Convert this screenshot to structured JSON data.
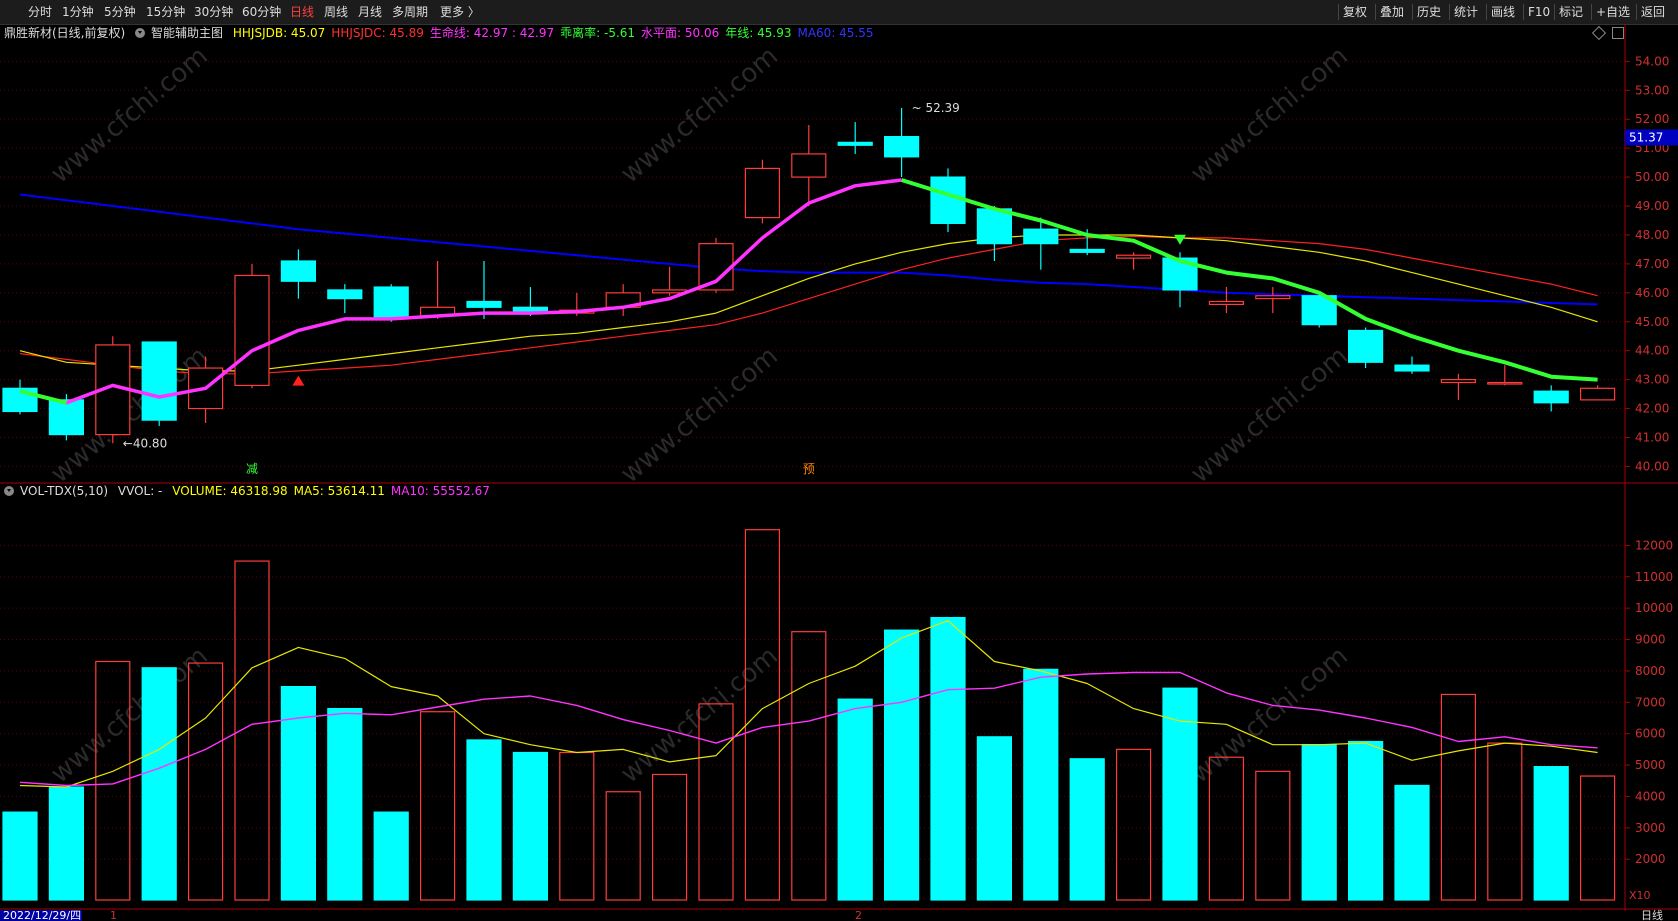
{
  "toolbar": {
    "periods": [
      "分时",
      "1分钟",
      "5分钟",
      "15分钟",
      "30分钟",
      "60分钟",
      "日线",
      "周线",
      "月线",
      "多周期",
      "更多 〉"
    ],
    "active_period": "日线",
    "right_buttons": [
      "复权",
      "叠加",
      "历史",
      "统计",
      "画线",
      "F10",
      "标记",
      "+自选",
      "返回"
    ]
  },
  "main_legend": {
    "stock": "鼎胜新材(日线,前复权)",
    "indicator": "智能辅助主图",
    "items": [
      {
        "text": "HHJSJDB: 45.07",
        "color": "#ffff00"
      },
      {
        "text": "HHJSJDC: 45.89",
        "color": "#ff3030"
      },
      {
        "text": "生命线: 42.97 : 42.97",
        "color": "#ff33ff"
      },
      {
        "text": "乖离率: -5.61",
        "color": "#33ff33"
      },
      {
        "text": "水平面: 50.06",
        "color": "#ff33ff"
      },
      {
        "text": "年线: 45.93",
        "color": "#33ff33"
      },
      {
        "text": "MA60: 45.55",
        "color": "#3333ff"
      }
    ]
  },
  "vol_legend": {
    "name": "VOL-TDX(5,10)",
    "vvol": "VVOL: -",
    "items": [
      {
        "text": "VOLUME: 46318.98",
        "color": "#ffff00"
      },
      {
        "text": "MA5: 53614.11",
        "color": "#ffff00"
      },
      {
        "text": "MA10: 55552.67",
        "color": "#ff33ff"
      }
    ]
  },
  "annotations": {
    "high_label": "52.39",
    "low_label": "40.80",
    "price_tag": "51.37",
    "signal_jian": "减",
    "signal_yu": "预",
    "vol_unit": "X10",
    "date_label": "2022/12/29/四",
    "month_1": "1",
    "month_2": "2",
    "period_label": "日线",
    "watermark": "www.cfchi.com"
  },
  "colors": {
    "up": "#ff3b3b",
    "down": "#00ffff",
    "grid": "#5a0000",
    "lifeline": "#ff33ff",
    "green_line": "#33ff33",
    "ma60": "#0000ff",
    "yellow": "#e6e600",
    "red_line": "#ff2020"
  },
  "chart_data": [
    {
      "type": "candlestick",
      "title": "鼎胜新材(日线,前复权)",
      "ylim": [
        39.6,
        54.6
      ],
      "y_ticks": [
        "54.00",
        "53.00",
        "52.00",
        "51.00",
        "50.00",
        "49.00",
        "48.00",
        "47.00",
        "46.00",
        "45.00",
        "44.00",
        "43.00",
        "42.00",
        "41.00",
        "40.00"
      ],
      "candles": [
        {
          "o": 42.7,
          "h": 43.0,
          "l": 41.8,
          "c": 41.9
        },
        {
          "o": 42.3,
          "h": 42.5,
          "l": 40.9,
          "c": 41.1
        },
        {
          "o": 41.1,
          "h": 44.5,
          "l": 40.8,
          "c": 44.2
        },
        {
          "o": 44.3,
          "h": 44.3,
          "l": 41.4,
          "c": 41.6
        },
        {
          "o": 42.0,
          "h": 43.8,
          "l": 41.5,
          "c": 43.4
        },
        {
          "o": 42.8,
          "h": 47.0,
          "l": 42.7,
          "c": 46.6
        },
        {
          "o": 47.1,
          "h": 47.5,
          "l": 45.8,
          "c": 46.4
        },
        {
          "o": 46.1,
          "h": 46.3,
          "l": 45.3,
          "c": 45.8
        },
        {
          "o": 46.2,
          "h": 46.3,
          "l": 45.0,
          "c": 45.1
        },
        {
          "o": 45.2,
          "h": 47.1,
          "l": 45.1,
          "c": 45.5
        },
        {
          "o": 45.7,
          "h": 47.1,
          "l": 45.1,
          "c": 45.5
        },
        {
          "o": 45.5,
          "h": 46.2,
          "l": 45.2,
          "c": 45.3
        },
        {
          "o": 45.3,
          "h": 46.0,
          "l": 45.2,
          "c": 45.4
        },
        {
          "o": 45.5,
          "h": 46.3,
          "l": 45.2,
          "c": 46.0
        },
        {
          "o": 46.0,
          "h": 46.9,
          "l": 45.9,
          "c": 46.1
        },
        {
          "o": 46.1,
          "h": 47.9,
          "l": 46.0,
          "c": 47.7
        },
        {
          "o": 48.6,
          "h": 50.6,
          "l": 48.4,
          "c": 50.3
        },
        {
          "o": 50.0,
          "h": 51.8,
          "l": 49.0,
          "c": 50.8
        },
        {
          "o": 51.2,
          "h": 51.9,
          "l": 50.8,
          "c": 51.1
        },
        {
          "o": 51.4,
          "h": 52.39,
          "l": 50.0,
          "c": 50.7
        },
        {
          "o": 50.0,
          "h": 50.3,
          "l": 48.1,
          "c": 48.4
        },
        {
          "o": 48.9,
          "h": 49.0,
          "l": 47.1,
          "c": 47.7
        },
        {
          "o": 48.2,
          "h": 48.6,
          "l": 46.8,
          "c": 47.7
        },
        {
          "o": 47.5,
          "h": 48.2,
          "l": 47.3,
          "c": 47.4
        },
        {
          "o": 47.2,
          "h": 47.4,
          "l": 46.8,
          "c": 47.3
        },
        {
          "o": 47.2,
          "h": 47.4,
          "l": 45.5,
          "c": 46.1
        },
        {
          "o": 45.6,
          "h": 46.2,
          "l": 45.3,
          "c": 45.7
        },
        {
          "o": 45.8,
          "h": 46.2,
          "l": 45.3,
          "c": 45.9
        },
        {
          "o": 45.9,
          "h": 46.0,
          "l": 44.8,
          "c": 44.9
        },
        {
          "o": 44.7,
          "h": 44.8,
          "l": 43.4,
          "c": 43.6
        },
        {
          "o": 43.5,
          "h": 43.8,
          "l": 43.2,
          "c": 43.3
        },
        {
          "o": 42.9,
          "h": 43.2,
          "l": 42.3,
          "c": 43.0
        },
        {
          "o": 42.9,
          "h": 43.5,
          "l": 42.8,
          "c": 42.9
        },
        {
          "o": 42.6,
          "h": 42.8,
          "l": 41.9,
          "c": 42.2
        },
        {
          "o": 42.3,
          "h": 42.8,
          "l": 42.3,
          "c": 42.7
        }
      ],
      "lines": [
        {
          "name": "生命线",
          "color": "#ff33ff",
          "values": [
            42.6,
            42.2,
            42.8,
            42.4,
            42.7,
            44.0,
            44.7,
            45.1,
            45.1,
            45.2,
            45.3,
            45.3,
            45.35,
            45.5,
            45.8,
            46.4,
            47.9,
            49.1,
            49.7,
            49.9,
            null,
            null,
            null,
            null,
            null,
            null,
            null,
            null,
            null,
            null,
            null,
            null,
            null,
            null,
            null
          ]
        },
        {
          "name": "乖离率",
          "color": "#33ff33",
          "values": [
            42.6,
            42.2,
            null,
            null,
            null,
            null,
            null,
            null,
            null,
            null,
            null,
            null,
            null,
            null,
            null,
            null,
            null,
            null,
            null,
            49.9,
            49.4,
            48.9,
            48.5,
            48.0,
            47.8,
            47.1,
            46.7,
            46.5,
            46.0,
            45.1,
            44.5,
            44.0,
            43.6,
            43.1,
            43.0
          ]
        },
        {
          "name": "MA60",
          "color": "#0000ff",
          "values": [
            49.4,
            49.2,
            49.0,
            48.8,
            48.6,
            48.4,
            48.2,
            48.05,
            47.9,
            47.75,
            47.6,
            47.45,
            47.3,
            47.15,
            47.0,
            46.85,
            46.75,
            46.7,
            46.7,
            46.7,
            46.6,
            46.45,
            46.35,
            46.3,
            46.2,
            46.1,
            46.0,
            45.95,
            45.9,
            45.85,
            45.8,
            45.75,
            45.7,
            45.65,
            45.6
          ]
        },
        {
          "name": "HHJSJDB",
          "color": "#e6e600",
          "values": [
            44.0,
            43.6,
            43.5,
            43.4,
            43.3,
            43.3,
            43.5,
            43.7,
            43.9,
            44.1,
            44.3,
            44.5,
            44.6,
            44.8,
            45.0,
            45.3,
            45.9,
            46.5,
            47.0,
            47.4,
            47.7,
            47.9,
            48.0,
            48.0,
            48.0,
            47.9,
            47.8,
            47.6,
            47.4,
            47.1,
            46.7,
            46.3,
            45.9,
            45.5,
            45.0
          ]
        },
        {
          "name": "HHJSJDC",
          "color": "#ff2020",
          "values": [
            43.9,
            43.7,
            43.5,
            43.3,
            43.2,
            43.2,
            43.3,
            43.4,
            43.5,
            43.7,
            43.9,
            44.1,
            44.3,
            44.5,
            44.7,
            44.9,
            45.3,
            45.8,
            46.3,
            46.8,
            47.2,
            47.5,
            47.8,
            47.9,
            47.95,
            47.9,
            47.9,
            47.8,
            47.7,
            47.5,
            47.2,
            46.9,
            46.6,
            46.3,
            45.9
          ]
        }
      ]
    },
    {
      "type": "bar",
      "title": "VOL-TDX(5,10)",
      "ylim": [
        700,
        13000
      ],
      "y_ticks": [
        "12000",
        "11000",
        "10000",
        "9000",
        "8000",
        "7000",
        "6000",
        "5000",
        "4000",
        "3000",
        "2000"
      ],
      "volumes": [
        3500,
        4300,
        8300,
        8100,
        8250,
        11500,
        7500,
        6800,
        3500,
        6700,
        5800,
        5400,
        5400,
        4150,
        4700,
        6950,
        12500,
        9250,
        7100,
        9300,
        9700,
        5900,
        8050,
        5200,
        5500,
        7450,
        5250,
        4800,
        5650,
        5750,
        4350,
        7250,
        5700,
        4950,
        4650
      ],
      "ma5": [
        4350,
        4300,
        4800,
        5500,
        6500,
        8100,
        8750,
        8400,
        7500,
        7200,
        6000,
        5650,
        5400,
        5500,
        5100,
        5300,
        6800,
        7600,
        8150,
        9050,
        9600,
        8300,
        8000,
        7600,
        6800,
        6400,
        6300,
        5650,
        5650,
        5700,
        5150,
        5450,
        5700,
        5600,
        5400
      ],
      "ma10": [
        4450,
        4350,
        4400,
        4900,
        5500,
        6300,
        6500,
        6650,
        6600,
        6850,
        7100,
        7200,
        6900,
        6450,
        6100,
        5700,
        6200,
        6400,
        6800,
        7000,
        7400,
        7450,
        7800,
        7900,
        7950,
        7950,
        7300,
        6900,
        6750,
        6500,
        6200,
        5750,
        5900,
        5650,
        5550
      ]
    }
  ]
}
